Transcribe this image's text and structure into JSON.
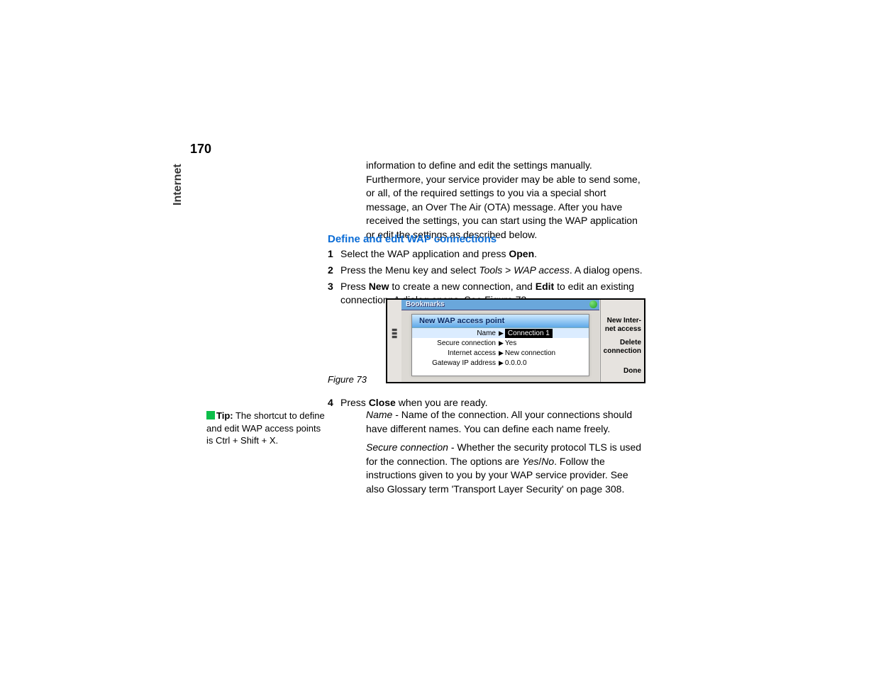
{
  "page": {
    "number": "170",
    "side_tab": "Internet"
  },
  "intro": "information to define and edit the settings manually. Furthermore, your service provider may be able to send some, or all, of the required settings to you via a special short message, an Over The Air (OTA) message. After you have received the settings, you can start using the WAP application or edit the settings as described below.",
  "heading": "Define and edit WAP connections",
  "steps": {
    "s1_num": "1",
    "s1_a": "Select the WAP application and press ",
    "s1_b": "Open",
    "s1_c": ".",
    "s2_num": "2",
    "s2_a": "Press the Menu key and select ",
    "s2_b": "Tools",
    "s2_c": " > ",
    "s2_d": "WAP access",
    "s2_e": ". A dialog opens.",
    "s3_num": "3",
    "s3_a": "Press ",
    "s3_b": "New",
    "s3_c": " to create a new connection, and ",
    "s3_d": "Edit",
    "s3_e": " to edit an existing connection. A dialog opens. See Figure 73.",
    "s4_num": "4",
    "s4_a": "Press ",
    "s4_b": "Close",
    "s4_c": " when you are ready."
  },
  "figure": {
    "caption": "Figure 73",
    "titlebar": "Bookmarks",
    "dialog_title": "New WAP access point",
    "rows": [
      {
        "label": "Name",
        "value": "Connection 1",
        "selected": true
      },
      {
        "label": "Secure connection",
        "value": "Yes",
        "selected": false
      },
      {
        "label": "Internet access",
        "value": "New connection",
        "selected": false
      },
      {
        "label": "Gateway IP address",
        "value": "0.0.0.0",
        "selected": false
      }
    ],
    "side_buttons": {
      "new": "New Inter-\nnet access",
      "delete": "Delete\nconnection",
      "done": "Done"
    }
  },
  "tip": {
    "label": "Tip:",
    "text": " The shortcut to define and edit WAP access points is Ctrl + Shift + X."
  },
  "para_name": {
    "a": "Name",
    "b": " - Name of the connection. All your connections should have different names. You can define each name freely."
  },
  "para_secure": {
    "a": "Secure connection",
    "b": " - Whether the security protocol TLS is used for the connection. The options are ",
    "c": "Yes",
    "d": "/",
    "e": "No",
    "f": ". Follow the instructions given to you by your WAP service provider. See also Glossary term 'Transport Layer Security' on page 308."
  }
}
